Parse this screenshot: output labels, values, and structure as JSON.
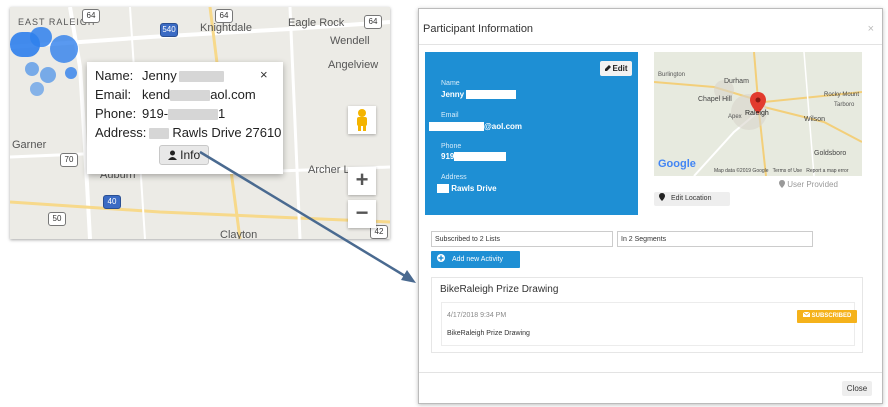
{
  "left_map": {
    "place_labels": {
      "east_raleigh": "EAST RALEIGH",
      "knightdale": "Knightdale",
      "eagle_rock": "Eagle Rock",
      "wendell": "Wendell",
      "angelview": "Angelview",
      "garner": "Garner",
      "auburn": "Auburn",
      "archer_lodge": "Archer Lo",
      "clayton": "Clayton"
    },
    "road_shields": {
      "i64_a": "64",
      "i64_b": "64",
      "r540": "540",
      "r64": "64",
      "r70": "70",
      "r40": "40",
      "r50": "50",
      "r42": "42"
    },
    "controls": {
      "zoom_in": "+",
      "zoom_out": "−"
    },
    "popup": {
      "name_label": "Name:",
      "name_value": "Jenny",
      "email_label": "Email:",
      "email_prefix": "kend",
      "email_suffix": "aol.com",
      "phone_label": "Phone:",
      "phone_prefix": "919-",
      "phone_suffix": "1",
      "address_label": "Address:",
      "address_value": "Rawls Drive 27610",
      "close": "×",
      "info_button": "Info"
    }
  },
  "modal": {
    "title": "Participant Information",
    "close_x": "×",
    "card": {
      "edit_button": "Edit",
      "name_label": "Name",
      "name_value": "Jenny",
      "email_label": "Email",
      "email_value": "@aol.com",
      "phone_label": "Phone",
      "phone_value": "919",
      "address_label": "Address",
      "address_value": "Rawls Drive"
    },
    "minimap": {
      "labels": {
        "burlington": "Burlington",
        "durham": "Durham",
        "chapel_hill": "Chapel Hill",
        "raleigh": "Raleigh",
        "rocky_mount": "Rocky Mount",
        "tarboro": "Tarboro",
        "wilson": "Wilson",
        "apex": "Apex",
        "goldsboro": "Goldsboro"
      },
      "google": "Google",
      "attribution": "Map data ©2019 Google   Terms of Use   Report a map error"
    },
    "user_provided": "User Provided",
    "edit_location": "Edit Location",
    "lists_field": "Subscribed to 2 Lists",
    "segments_field": "In 2 Segments",
    "add_activity": "Add new Activity",
    "activity": {
      "title": "BikeRaleigh Prize Drawing",
      "datetime": "4/17/2018 9:34 PM",
      "description": "BikeRaleigh Prize Drawing",
      "badge": "SUBSCRIBED"
    },
    "close_button": "Close"
  },
  "colors": {
    "primary": "#1e8fd4",
    "badge": "#f5b21b",
    "arrow": "#4a6a90",
    "cluster": "#2f80ec"
  }
}
